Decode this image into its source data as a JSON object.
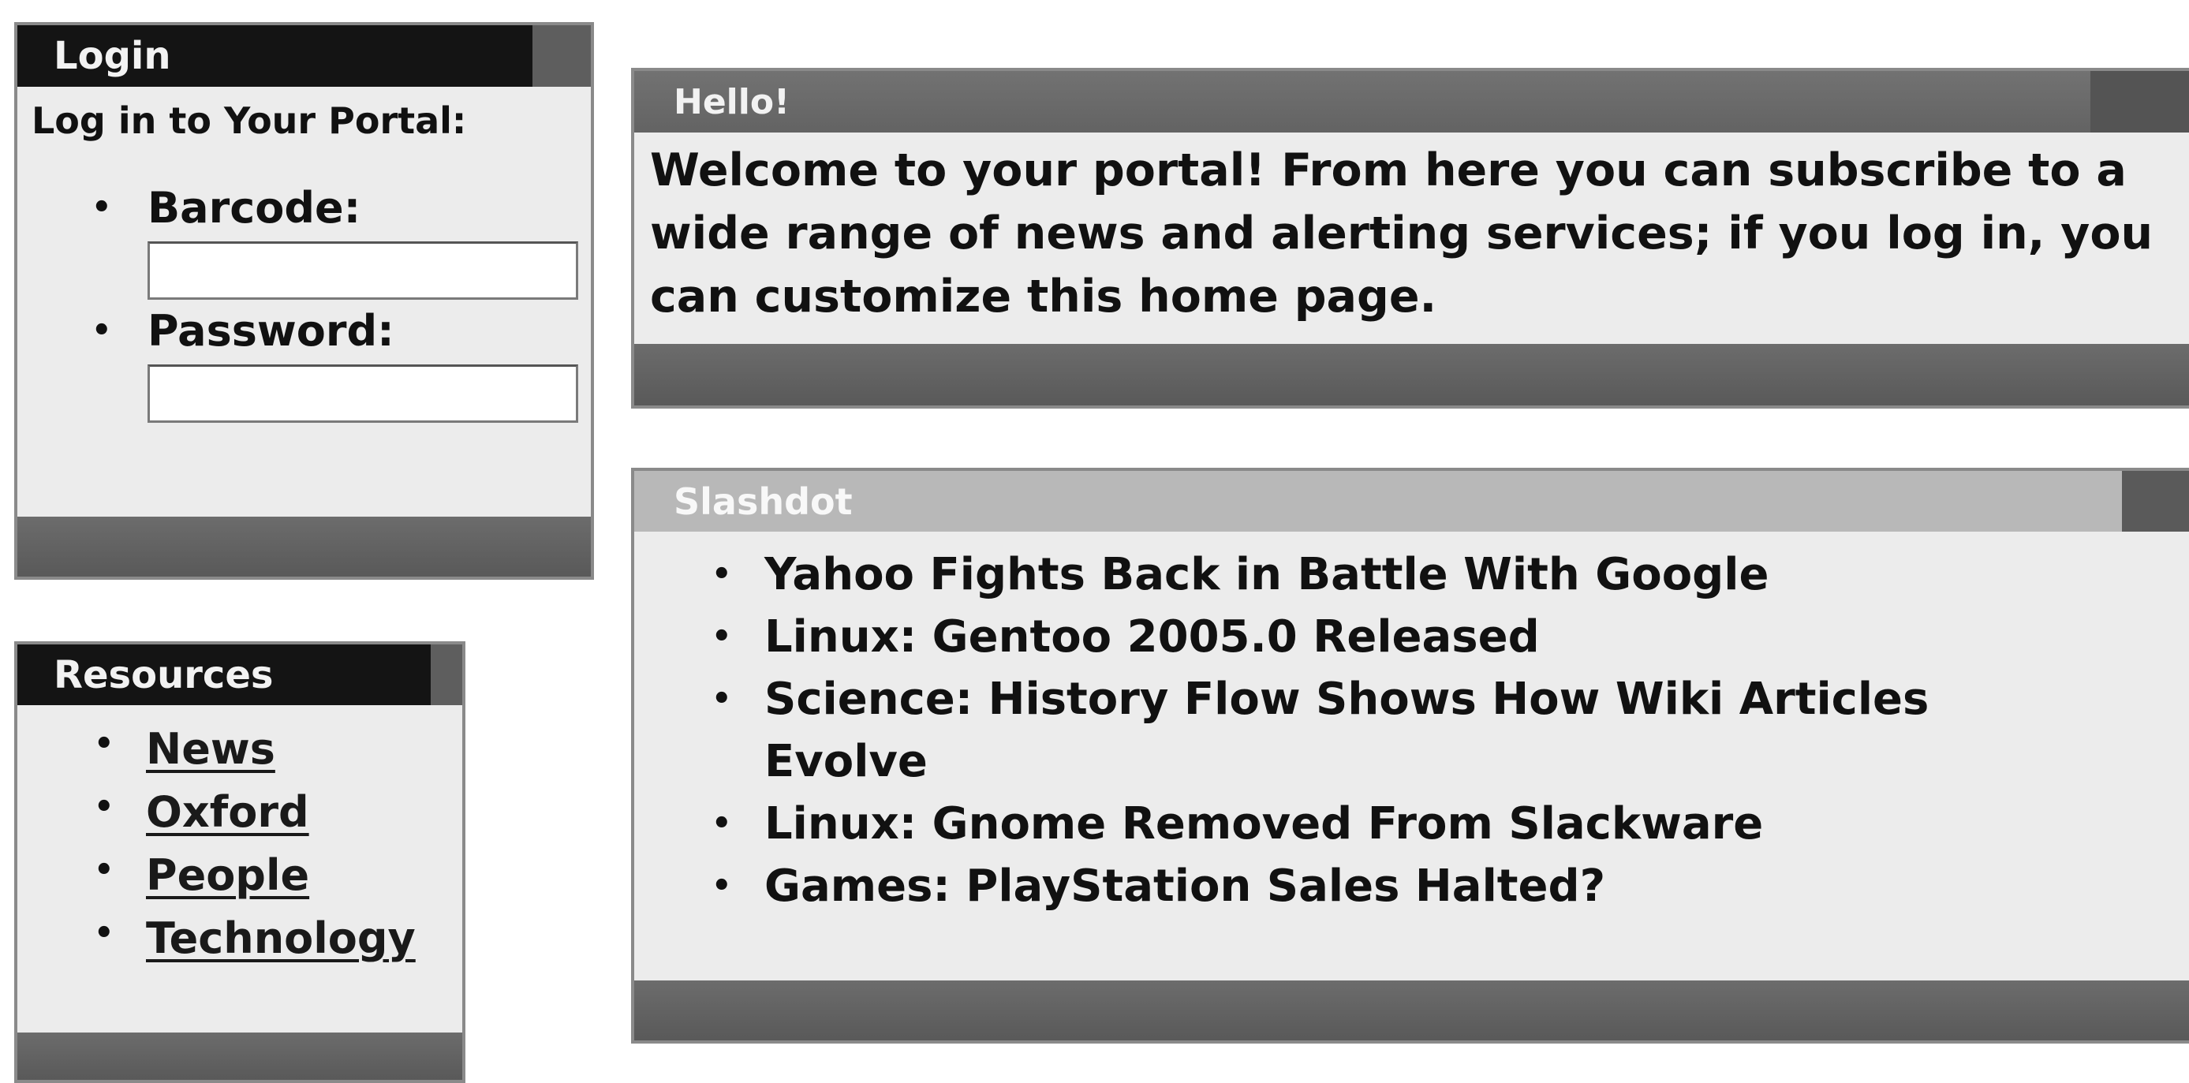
{
  "login": {
    "title": "Login",
    "intro": "Log in to Your Portal:",
    "fields": [
      {
        "label": "Barcode:",
        "value": ""
      },
      {
        "label": "Password:",
        "value": ""
      }
    ]
  },
  "resources": {
    "title": "Resources",
    "links": [
      "News",
      "Oxford",
      "People",
      "Technology"
    ]
  },
  "hello": {
    "title": "Hello!",
    "message": "Welcome to your portal! From here you can subscribe to a wide range of news and alerting services; if you log in, you can customize this home page."
  },
  "slashdot": {
    "title": "Slashdot",
    "items": [
      "Yahoo Fights Back in Battle With Google",
      "Linux: Gentoo 2005.0 Released",
      "Science: History Flow Shows How Wiki Articles Evolve",
      "Linux: Gnome Removed From Slackware",
      "Games: PlayStation Sales Halted?"
    ]
  },
  "colors": {
    "dark_header": "#141414",
    "mid_header": "#6a6a6a",
    "light_header": "#b8b8b8",
    "panel_bg": "#ececec",
    "footer_bar": "#626262"
  }
}
